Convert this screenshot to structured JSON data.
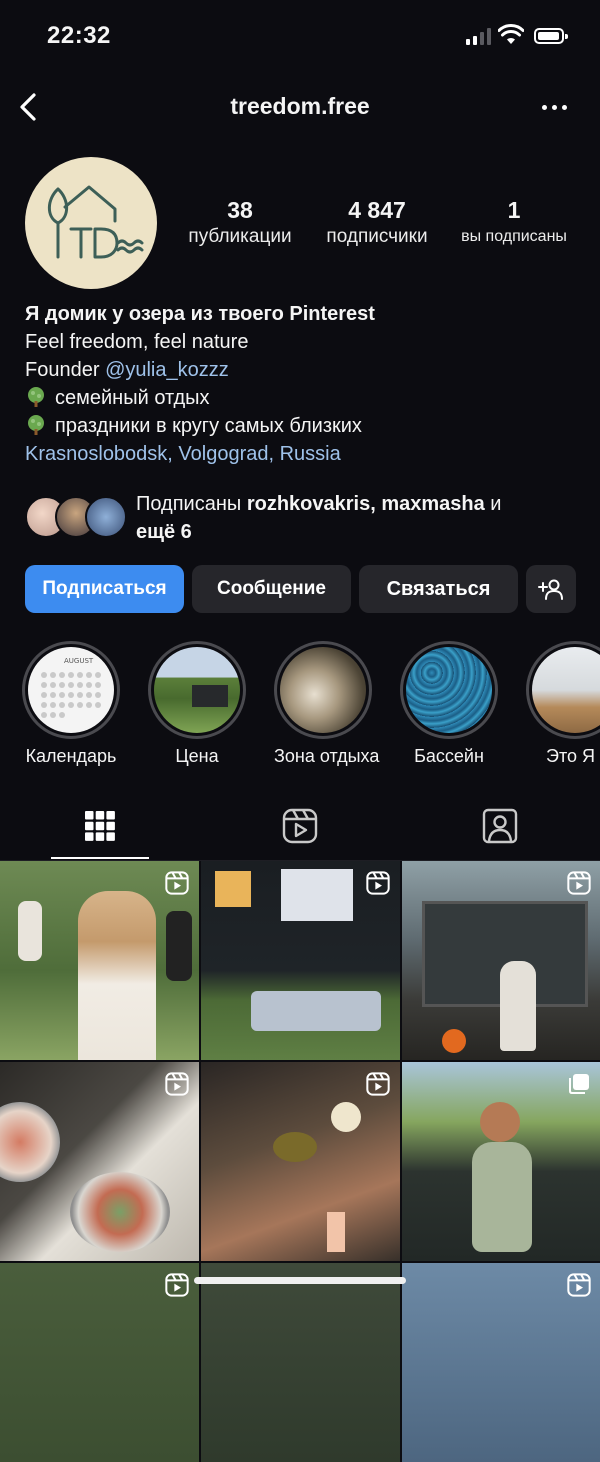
{
  "status_bar": {
    "time": "22:32"
  },
  "nav": {
    "title": "treedom.free"
  },
  "stats": [
    {
      "count": "38",
      "label": "публикации"
    },
    {
      "count": "4 847",
      "label": "подписчики"
    },
    {
      "count": "1",
      "label": "вы подписаны"
    }
  ],
  "bio": {
    "name": "Я домик у озера из твоего Pinterest",
    "line1": "Feel freedom, feel nature",
    "founder_prefix": "Founder ",
    "founder_link": "@yulia_kozzz",
    "item1": "семейный отдых",
    "item2": "праздники в кругу самых близких",
    "location": "Krasnoslobodsk, Volgograd, Russia"
  },
  "followed_by": {
    "prefix": "Подписаны ",
    "names": "rozhkovakris, maxmasha",
    "suffix": " и",
    "more": "ещё 6"
  },
  "buttons": {
    "follow": "Подписаться",
    "message": "Сообщение",
    "contact": "Связаться"
  },
  "highlights": [
    {
      "label": "Календарь"
    },
    {
      "label": "Цена"
    },
    {
      "label": "Зона отдыха"
    },
    {
      "label": "Бассейн"
    },
    {
      "label": "Это Я"
    }
  ],
  "calendar_month": "AUGUST",
  "colors": {
    "accent": "#3d8cf0",
    "link": "#9fc2ea",
    "background": "#0c0c11"
  }
}
